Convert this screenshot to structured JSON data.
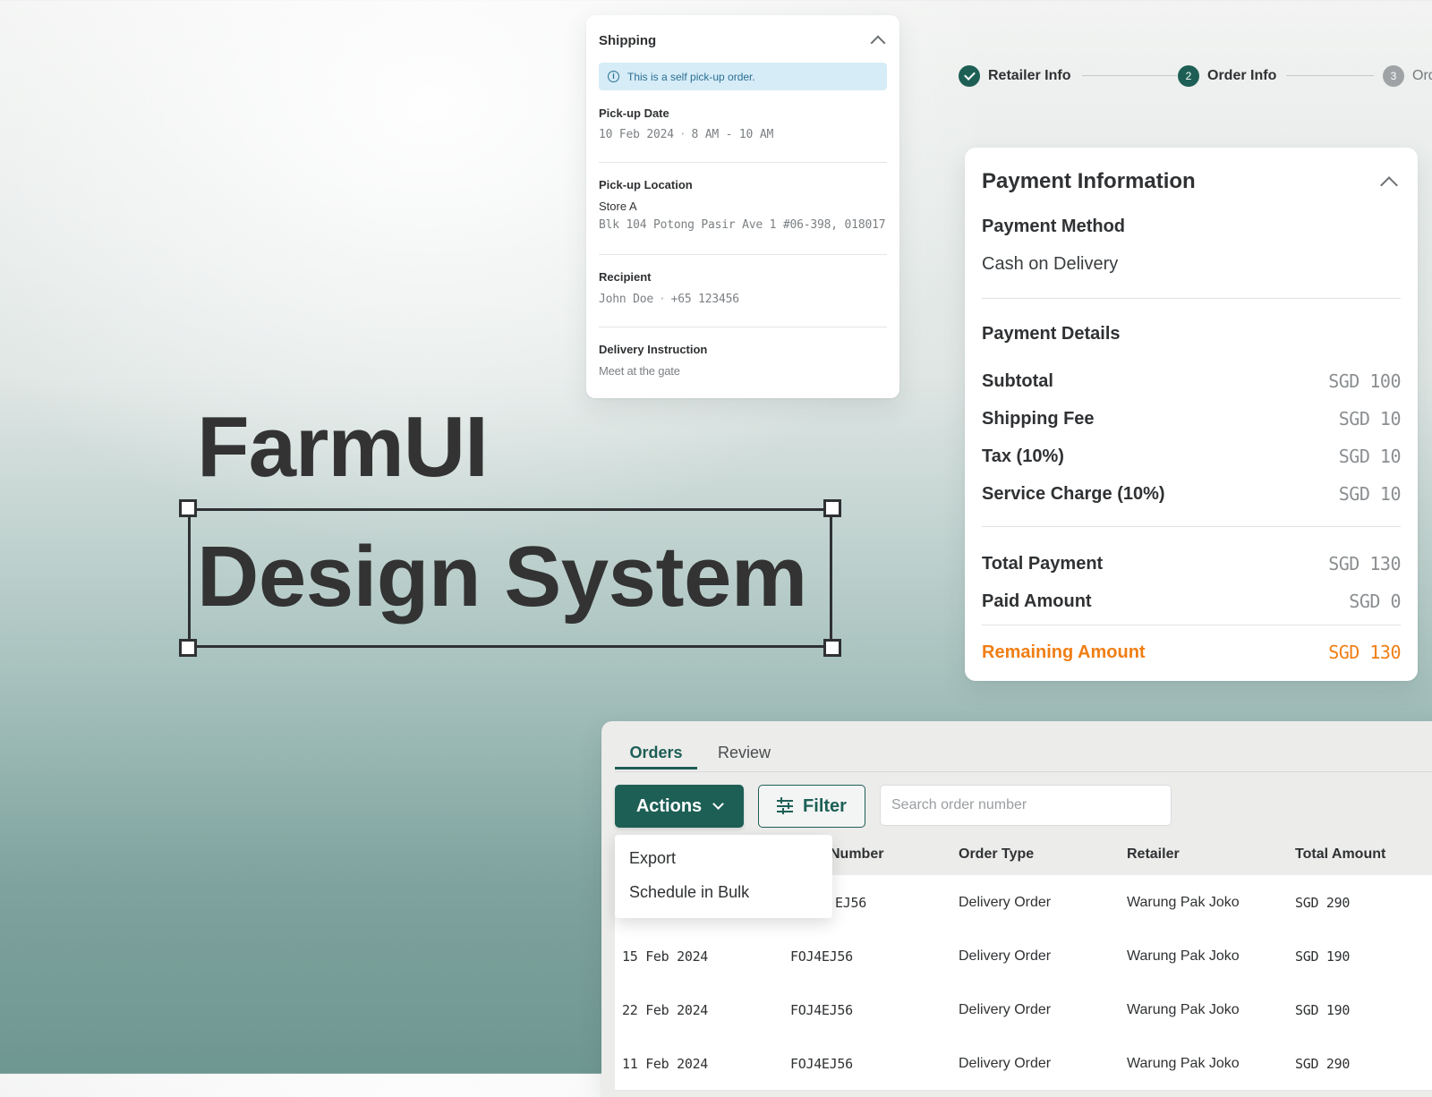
{
  "shipping": {
    "title": "Shipping",
    "banner": "This is a self pick-up order.",
    "pickup_date_label": "Pick-up Date",
    "pickup_date": "10 Feb 2024",
    "pickup_time": "8 AM - 10 AM",
    "pickup_location_label": "Pick-up Location",
    "store_name": "Store A",
    "store_address": "Blk 104 Potong Pasir Ave 1 #06-398, 018017",
    "recipient_label": "Recipient",
    "recipient_name": "John Doe",
    "recipient_phone": "+65 123456",
    "instruction_label": "Delivery Instruction",
    "instruction": "Meet at the gate"
  },
  "hero": {
    "line1": "FarmUI",
    "line2": "Design System"
  },
  "stepper": {
    "steps": [
      {
        "number": "1",
        "label": "Retailer Info",
        "state": "done"
      },
      {
        "number": "2",
        "label": "Order Info",
        "state": "active"
      },
      {
        "number": "3",
        "label": "Ord",
        "state": "pending"
      }
    ],
    "colors": {
      "done": "#1d5f55",
      "active": "#1d5f55",
      "pending": "#9fa3a5"
    }
  },
  "payment": {
    "title": "Payment Information",
    "method_label": "Payment Method",
    "method": "Cash on Delivery",
    "details_label": "Payment Details",
    "rows": [
      {
        "label": "Subtotal",
        "value": "SGD 100"
      },
      {
        "label": "Shipping Fee",
        "value": "SGD 10"
      },
      {
        "label": "Tax (10%)",
        "value": "SGD 10"
      },
      {
        "label": "Service Charge (10%)",
        "value": "SGD 10"
      }
    ],
    "total_label": "Total Payment",
    "total": "SGD 130",
    "paid_label": "Paid Amount",
    "paid": "SGD 0",
    "remaining_label": "Remaining Amount",
    "remaining": "SGD 130",
    "accent_color": "#f07e14"
  },
  "orders": {
    "tabs": [
      {
        "label": "Orders"
      },
      {
        "label": "Review"
      }
    ],
    "actions_label": "Actions",
    "filter_label": "Filter",
    "search_placeholder": "Search order number",
    "dropdown": [
      "Export",
      "Schedule in Bulk"
    ],
    "columns": [
      "",
      "Number",
      "Order Type",
      "Retailer",
      "Total Amount"
    ],
    "rows": [
      {
        "date": "",
        "number": "EJ56",
        "type": "Delivery Order",
        "retailer": "Warung Pak Joko",
        "amount": "SGD 290"
      },
      {
        "date": "15 Feb 2024",
        "number": "FOJ4EJ56",
        "type": "Delivery Order",
        "retailer": "Warung Pak Joko",
        "amount": "SGD 190"
      },
      {
        "date": "22 Feb 2024",
        "number": "FOJ4EJ56",
        "type": "Delivery Order",
        "retailer": "Warung Pak Joko",
        "amount": "SGD 190"
      },
      {
        "date": "11 Feb 2024",
        "number": "FOJ4EJ56",
        "type": "Delivery Order",
        "retailer": "Warung Pak Joko",
        "amount": "SGD 290"
      }
    ],
    "brand_color": "#1d5f55"
  }
}
